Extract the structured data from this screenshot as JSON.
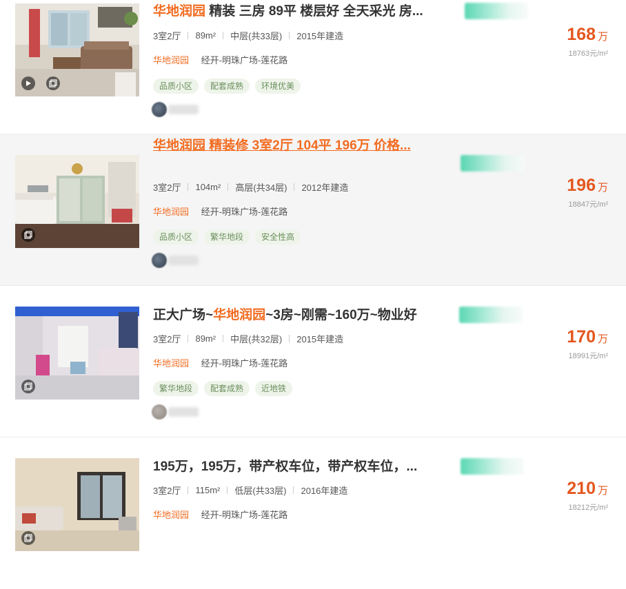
{
  "listings": [
    {
      "title_highlight": "华地润园",
      "title_rest": " 精装 三房 89平 楼层好 全天采光 房...",
      "layout": "3室2厅",
      "area": "89m²",
      "floor": "中层(共33层)",
      "built": "2015年建造",
      "community": "华地润园",
      "district": "经开-明珠广场-莲花路",
      "tags": [
        "品质小区",
        "配套成熟",
        "环境优美"
      ],
      "price": "168",
      "price_unit": "万",
      "unit_price": "18763元/m²",
      "media_icons": [
        "play-icon",
        "album-icon"
      ]
    },
    {
      "title_highlight": "华地润园",
      "title_rest": " 精装修 3室2厅 104平 196万 价格...",
      "layout": "3室2厅",
      "area": "104m²",
      "floor": "高层(共34层)",
      "built": "2012年建造",
      "community": "华地润园",
      "district": "经开-明珠广场-莲花路",
      "tags": [
        "品质小区",
        "繁华地段",
        "安全性高"
      ],
      "price": "196",
      "price_unit": "万",
      "unit_price": "18847元/m²",
      "media_icons": [
        "album-icon"
      ]
    },
    {
      "title_prefix": "正大广场~",
      "title_highlight": "华地润园",
      "title_rest": "~3房~刚需~160万~物业好",
      "layout": "3室2厅",
      "area": "89m²",
      "floor": "中层(共32层)",
      "built": "2015年建造",
      "community": "华地润园",
      "district": "经开-明珠广场-莲花路",
      "tags": [
        "繁华地段",
        "配套成熟",
        "近地铁"
      ],
      "price": "170",
      "price_unit": "万",
      "unit_price": "18991元/m²",
      "media_icons": [
        "album-icon"
      ]
    },
    {
      "title_rest": "195万，195万，带产权车位，带产权车位，...",
      "layout": "3室2厅",
      "area": "115m²",
      "floor": "低层(共33层)",
      "built": "2016年建造",
      "community": "华地润园",
      "district": "经开-明珠广场-莲花路",
      "tags": [
        "",
        "",
        ""
      ],
      "price": "210",
      "price_unit": "万",
      "unit_price": "18212元/m²",
      "media_icons": [
        "album-icon"
      ]
    }
  ],
  "colors": {
    "accent": "#f26c21",
    "price": "#e4561e",
    "tag_bg": "#eef4ea",
    "tag_text": "#6b8f5d",
    "hover_row_bg": "#f5f5f5"
  }
}
